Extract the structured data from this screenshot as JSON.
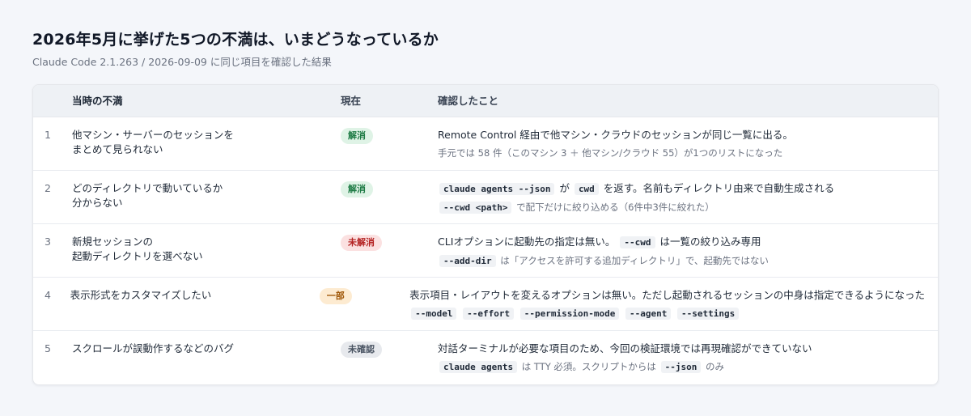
{
  "page": {
    "title": "2026年5月に挙げた5つの不満は、いまどうなっているか",
    "subtitle": "Claude Code 2.1.263 / 2026-09-09 に同じ項目を確認した結果"
  },
  "table": {
    "headers": {
      "num": "",
      "issue": "当時の不満",
      "status": "現在",
      "note": "確認したこと"
    },
    "rows": [
      {
        "num": "1",
        "issue_line1": "他マシン・サーバーのセッションを",
        "issue_line2": "まとめて見られない",
        "status": "解消",
        "main_a": "Remote Control 経由で他マシン・クラウドのセッションが同じ一覧に出る。",
        "sub_a": "手元では 58 件（このマシン 3 ＋ 他マシン/クラウド 55）が1つのリストになった"
      },
      {
        "num": "2",
        "issue_line1": "どのディレクトリで動いているか",
        "issue_line2": "分からない",
        "status": "解消",
        "main_code1": "claude agents --json",
        "main_a": "が",
        "main_code2": "cwd",
        "main_b": "を返す。名前もディレクトリ由来で自動生成される",
        "sub_code1": "--cwd <path>",
        "sub_a": "で配下だけに絞り込める（6件中3件に絞れた）"
      },
      {
        "num": "3",
        "issue_line1": "新規セッションの",
        "issue_line2": "起動ディレクトリを選べない",
        "status": "未解消",
        "main_a": "CLIオプションに起動先の指定は無い。",
        "main_code1": "--cwd",
        "main_b": "は一覧の絞り込み専用",
        "sub_code1": "--add-dir",
        "sub_a": "は「アクセスを許可する追加ディレクトリ」で、起動先ではない"
      },
      {
        "num": "4",
        "issue_line1": "表示形式をカスタマイズしたい",
        "issue_line2": "",
        "status": "一部",
        "main_a": "表示項目・レイアウトを変えるオプションは無い。ただし起動されるセッションの中身は指定できるようになった",
        "sub_codes": [
          "--model",
          "--effort",
          "--permission-mode",
          "--agent",
          "--settings"
        ]
      },
      {
        "num": "5",
        "issue_line1": "スクロールが誤動作するなどのバグ",
        "issue_line2": "",
        "status": "未確認",
        "main_a": "対話ターミナルが必要な項目のため、今回の検証環境では再現確認ができていない",
        "sub_code1": "claude agents",
        "sub_a": "は TTY 必須。スクリプトからは",
        "sub_code2": "--json",
        "sub_b": "のみ"
      }
    ]
  },
  "colors": {
    "solved": "#1e7b45",
    "unsolved": "#b42323",
    "partial": "#a1590a",
    "unknown": "#4b5563"
  }
}
